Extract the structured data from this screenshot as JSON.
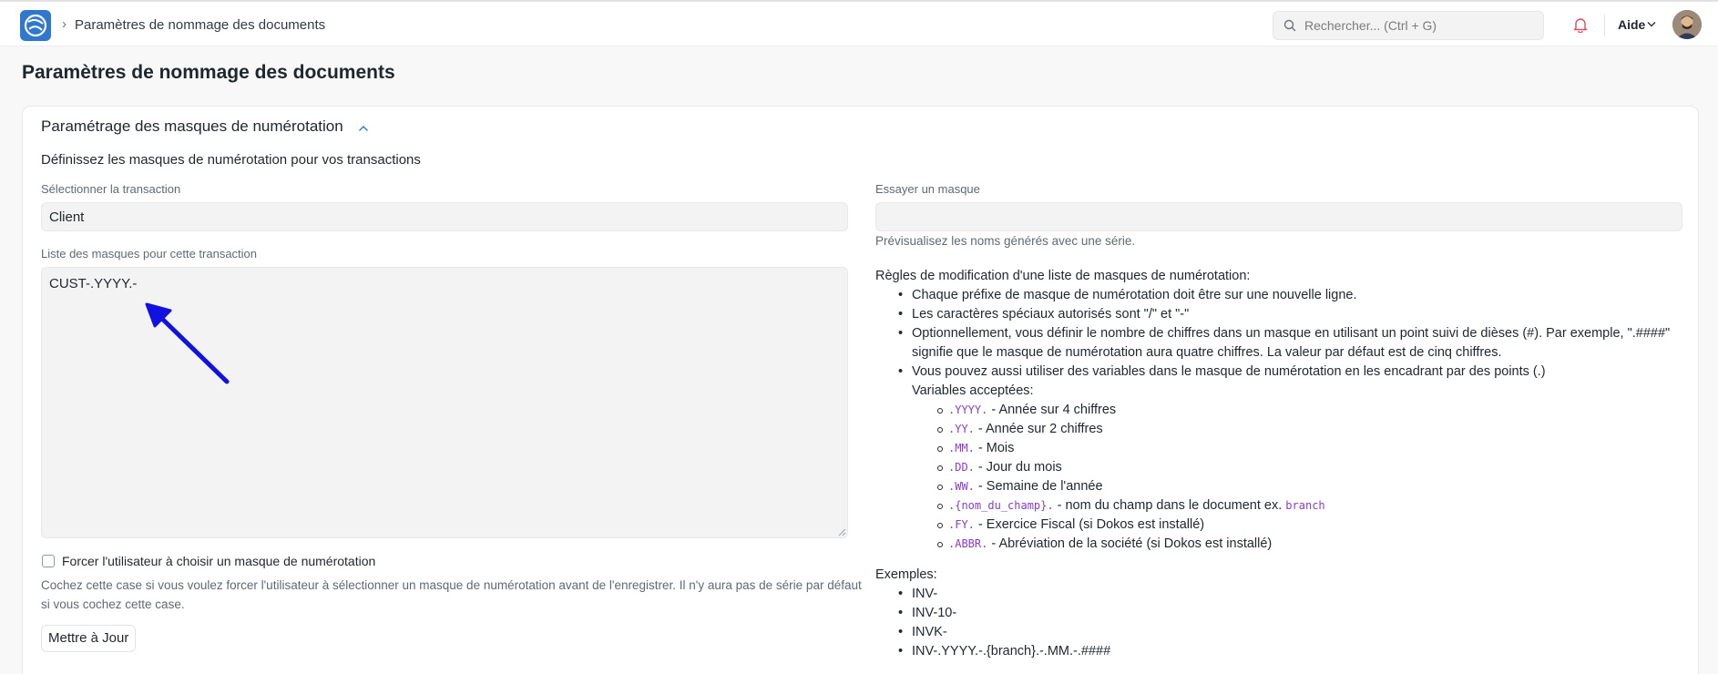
{
  "navbar": {
    "breadcrumb_sep": "›",
    "breadcrumb": "Paramètres de nommage des documents",
    "search_placeholder": "Rechercher... (Ctrl + G)",
    "help_label": "Aide"
  },
  "page": {
    "title": "Paramètres de nommage des documents"
  },
  "section": {
    "title": "Paramétrage des masques de numérotation",
    "description": "Définissez les masques de numérotation pour vos transactions"
  },
  "form": {
    "transaction_label": "Sélectionner la transaction",
    "transaction_value": "Client",
    "series_label": "Liste des masques pour cette transaction",
    "series_value": "CUST-.YYYY.-",
    "force_label": "Forcer l'utilisateur à choisir un masque de numérotation",
    "force_checked": false,
    "force_help": "Cochez cette case si vous voulez forcer l'utilisateur à sélectionner un masque de numérotation avant de l'enregistrer. Il n'y aura pas de série par défaut si vous cochez cette case.",
    "update_button": "Mettre à Jour",
    "try_label": "Essayer un masque",
    "try_value": "",
    "preview_help": "Prévisualisez les noms générés avec une série."
  },
  "rules": {
    "title": "Règles de modification d'une liste de masques de numérotation:",
    "items": [
      "Chaque préfixe de masque de numérotation doit être sur une nouvelle ligne.",
      "Les caractères spéciaux autorisés sont \"/\" et \"-\"",
      "Optionnellement, vous définir le nombre de chiffres dans un masque en utilisant un point suivi de dièses (#). Par exemple, \".####\" signifie que le masque de numérotation aura quatre chiffres. La valeur par défaut est de cinq chiffres.",
      "Vous pouvez aussi utiliser des variables dans le masque de numérotation en les encadrant par des points (.)"
    ],
    "variables_title": "Variables acceptées:",
    "variables": [
      {
        "code": ".YYYY.",
        "desc": " - Année sur 4 chiffres"
      },
      {
        "code": ".YY.",
        "desc": " - Année sur 2 chiffres"
      },
      {
        "code": ".MM.",
        "desc": " - Mois"
      },
      {
        "code": ".DD.",
        "desc": " - Jour du mois"
      },
      {
        "code": ".WW.",
        "desc": " - Semaine de l'année"
      },
      {
        "code": ".{nom_du_champ}.",
        "desc": " - nom du champ dans le document ex. ",
        "extra_code": "branch"
      },
      {
        "code": ".FY.",
        "desc": " - Exercice Fiscal (si Dokos est installé)"
      },
      {
        "code": ".ABBR.",
        "desc": " - Abréviation de la société (si Dokos est installé)"
      }
    ],
    "examples_title": "Exemples:",
    "examples": [
      "INV-",
      "INV-10-",
      "INVK-",
      "INV-.YYYY.-.{branch}.-.MM.-.####"
    ]
  },
  "colors": {
    "accent_blue": "#2f78cd",
    "annotation_arrow": "#1111e0",
    "code_purple": "#8a3cc7"
  }
}
